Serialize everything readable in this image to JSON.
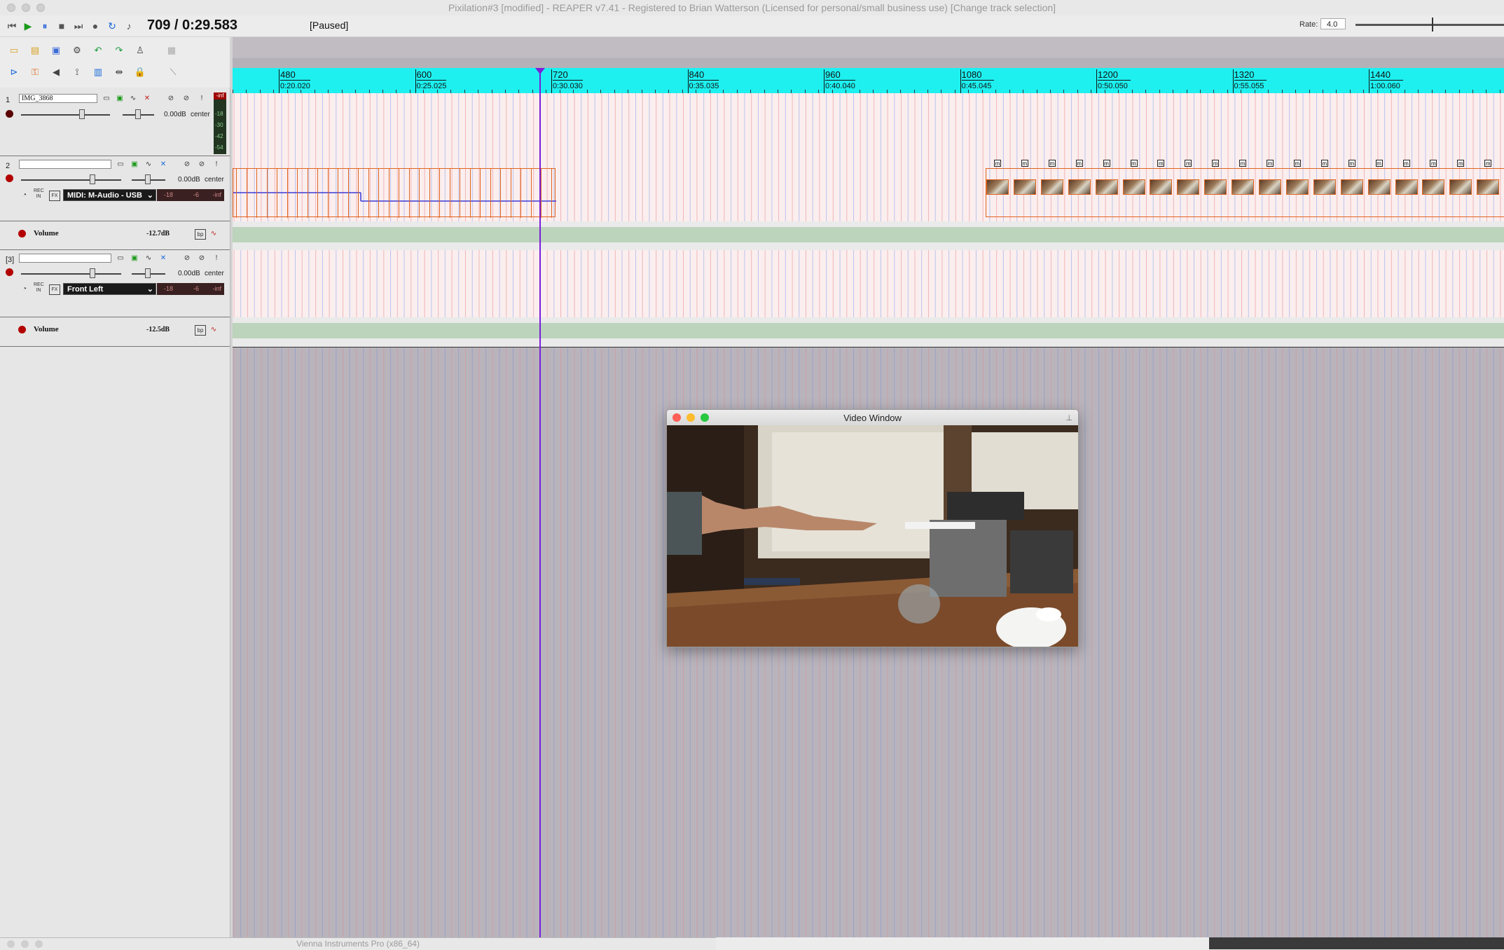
{
  "window": {
    "title": "Pixilation#3 [modified] - REAPER v7.41 - Registered to Brian Watterson (Licensed for personal/small business use) [Change track selection]"
  },
  "transport": {
    "time": "709 / 0:29.583",
    "status": "[Paused]",
    "rate_label": "Rate:",
    "rate_value": "4.0"
  },
  "ruler": {
    "marks": [
      {
        "frame": "480",
        "time": "0:20.020"
      },
      {
        "frame": "600",
        "time": "0:25.025"
      },
      {
        "frame": "720",
        "time": "0:30.030"
      },
      {
        "frame": "840",
        "time": "0:35.035"
      },
      {
        "frame": "960",
        "time": "0:40.040"
      },
      {
        "frame": "1080",
        "time": "0:45.045"
      },
      {
        "frame": "1200",
        "time": "0:50.050"
      },
      {
        "frame": "1320",
        "time": "0:55.055"
      },
      {
        "frame": "1440",
        "time": "1:00.060"
      }
    ]
  },
  "tracks": [
    {
      "num": "1",
      "name": "IMG_3868",
      "vol": "0.00dB",
      "pan": "center",
      "meter_labels": [
        "-inf",
        "-18",
        "-30",
        "-42",
        "-54"
      ]
    },
    {
      "num": "2",
      "name": "",
      "vol": "0.00dB",
      "pan": "center",
      "input": "MIDI: M-Audio - USB",
      "meter_a": "-18",
      "meter_b": "-6",
      "meter_c": "-inf",
      "rec_in": "REC IN",
      "fx": "FX"
    },
    {
      "num": "[3]",
      "name": "",
      "vol": "0.00dB",
      "pan": "center",
      "input": "Front Left",
      "meter_a": "-18",
      "meter_b": "-6",
      "meter_c": "-inf",
      "rec_in": "REC IN",
      "fx": "FX"
    }
  ],
  "envelopes": [
    {
      "label": "Volume",
      "value": "-12.7dB",
      "bp": "bp"
    },
    {
      "label": "Volume",
      "value": "-12.5dB",
      "bp": "bp"
    }
  ],
  "video_window": {
    "title": "Video Window"
  },
  "bottom_window": {
    "title": "Vienna Instruments Pro (x86_64)"
  },
  "colors": {
    "ruler": "#1ef0f0",
    "playhead": "#7a1fd8",
    "item_border": "#e0641e",
    "record": "#b30000"
  }
}
